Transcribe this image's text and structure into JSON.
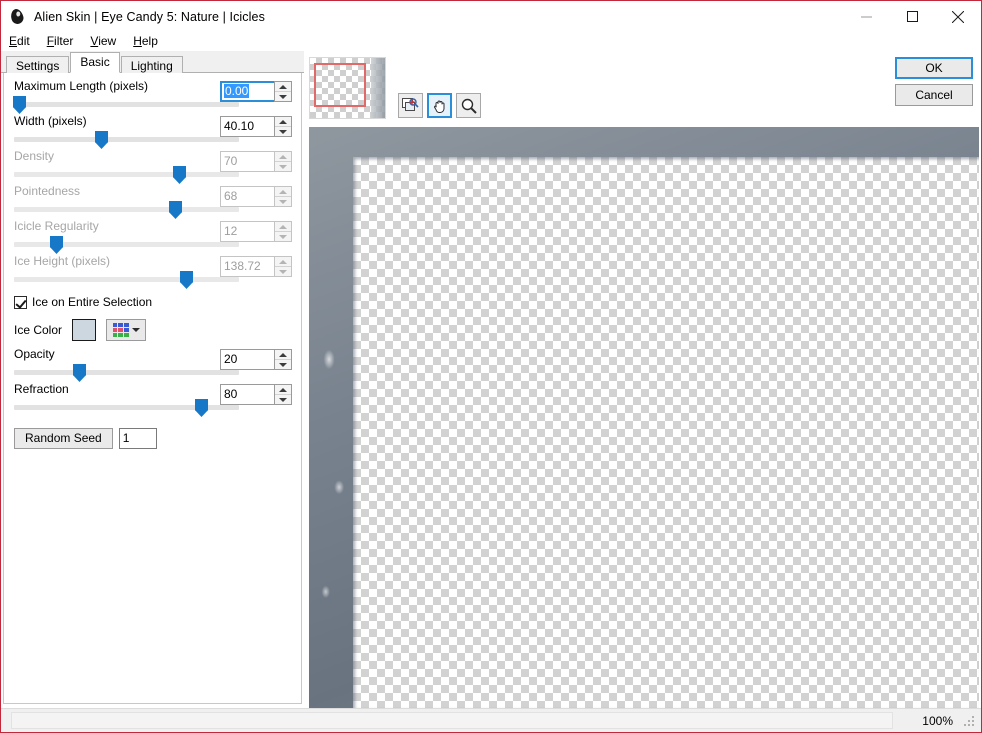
{
  "window": {
    "title": "Alien Skin | Eye Candy 5: Nature | Icicles",
    "app_icon": "alien-head-icon",
    "controls": {
      "minimize": "minimize-icon",
      "maximize": "maximize-icon",
      "close": "close-icon"
    },
    "border_color": "#c1283c"
  },
  "menubar": {
    "items": [
      {
        "label": "Edit",
        "accel": "E"
      },
      {
        "label": "Filter",
        "accel": "F"
      },
      {
        "label": "View",
        "accel": "V"
      },
      {
        "label": "Help",
        "accel": "H"
      }
    ]
  },
  "tabs": [
    {
      "label": "Settings",
      "active": false
    },
    {
      "label": "Basic",
      "active": true
    },
    {
      "label": "Lighting",
      "active": false
    }
  ],
  "controls": {
    "sliders": [
      {
        "label": "Maximum Length (pixels)",
        "value": "0.00",
        "percent": 2,
        "enabled": true,
        "focused": true
      },
      {
        "label": "Width (pixels)",
        "value": "40.10",
        "percent": 38,
        "enabled": true,
        "focused": false
      },
      {
        "label": "Density",
        "value": "70",
        "percent": 71,
        "enabled": false,
        "focused": false
      },
      {
        "label": "Pointedness",
        "value": "68",
        "percent": 69,
        "enabled": false,
        "focused": false
      },
      {
        "label": "Icicle Regularity",
        "value": "12",
        "percent": 17,
        "enabled": false,
        "focused": false
      },
      {
        "label": "Ice Height (pixels)",
        "value": "138.72",
        "percent": 74,
        "enabled": false,
        "focused": false
      }
    ],
    "checkbox": {
      "label": "Ice on Entire Selection",
      "checked": true
    },
    "ice_color": {
      "label": "Ice Color",
      "swatch_hex": "#ccd7e0",
      "palette_icon": "color-palette-icon",
      "caret_icon": "chevron-down-icon"
    },
    "post_sliders": [
      {
        "label": "Opacity",
        "value": "20",
        "percent": 17,
        "enabled": true
      },
      {
        "label": "Refraction",
        "value": "80",
        "percent": 77,
        "enabled": true
      }
    ],
    "random_seed": {
      "button_label": "Random Seed",
      "value": "1"
    }
  },
  "preview": {
    "navigator": {
      "name": "navigator-thumbnail",
      "viewport_color": "#e06a6a"
    },
    "tools": [
      {
        "name": "fit-preview-icon",
        "active": false
      },
      {
        "name": "hand-pan-icon",
        "active": true
      },
      {
        "name": "zoom-magnifier-icon",
        "active": false
      }
    ]
  },
  "buttons": {
    "ok": "OK",
    "cancel": "Cancel"
  },
  "statusbar": {
    "zoom": "100%",
    "grip": "resize-grip-icon"
  }
}
